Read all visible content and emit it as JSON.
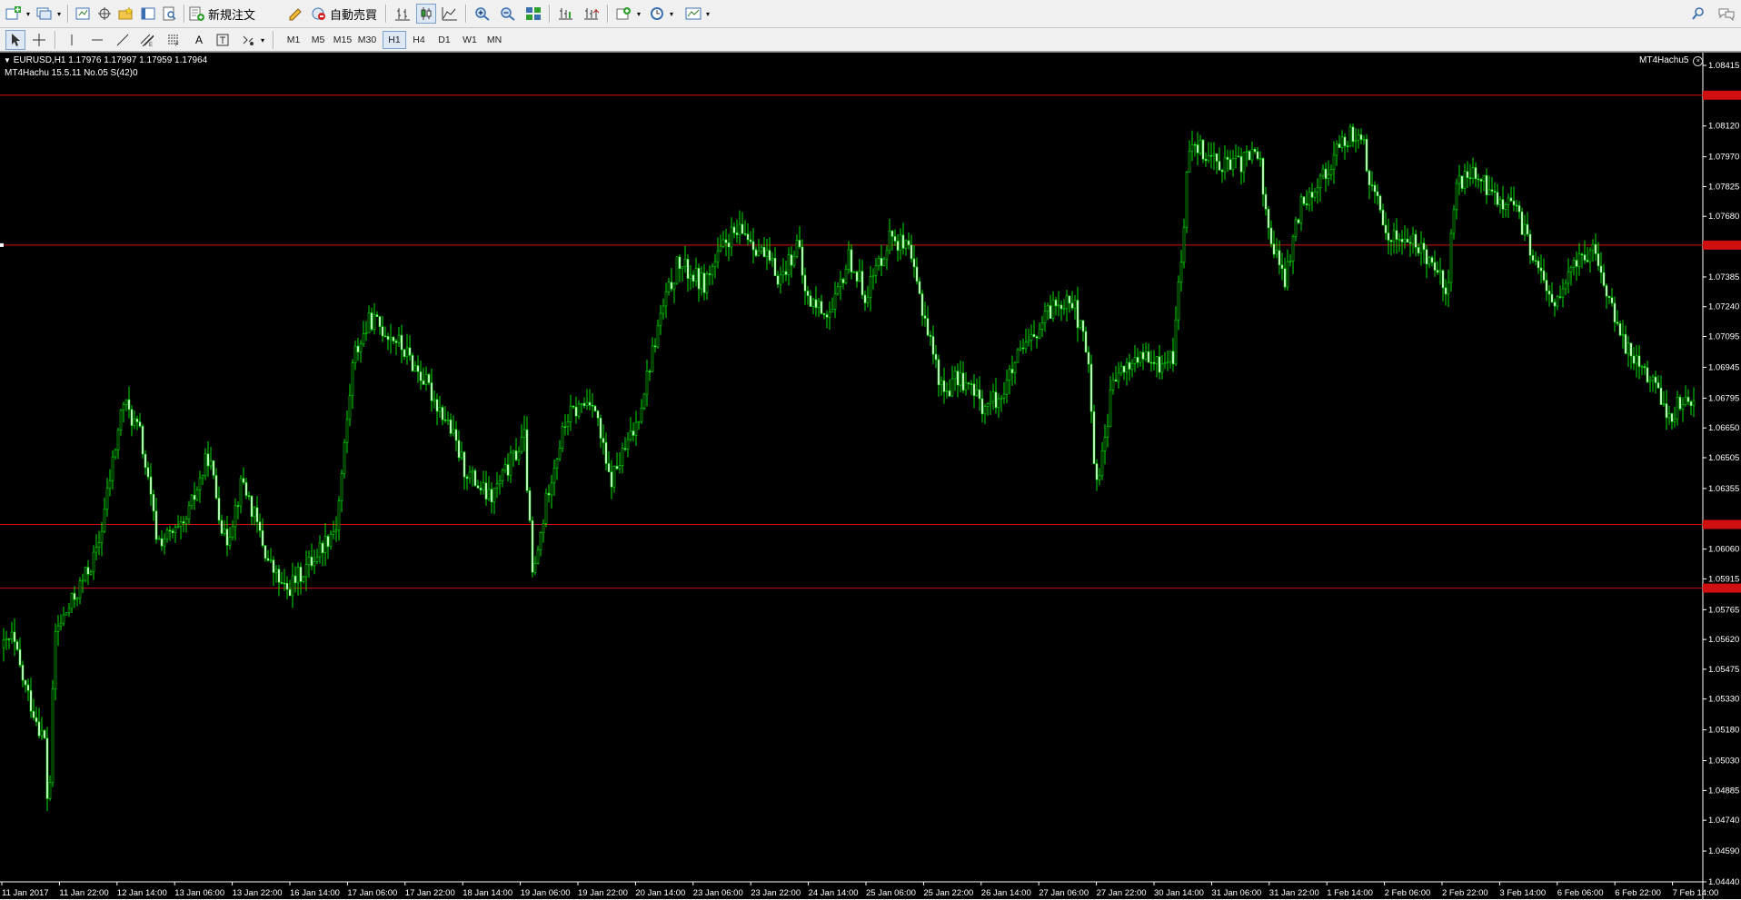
{
  "toolbar": {
    "new_order_label": "新規注文",
    "auto_trading_label": "自動売買",
    "timeframes": [
      "M1",
      "M5",
      "M15",
      "M30",
      "H1",
      "H4",
      "D1",
      "W1",
      "MN"
    ],
    "active_timeframe": "H1"
  },
  "chart_header": {
    "symbol_line": "EURUSD,H1  1.17976 1.17997 1.17959 1.17964",
    "indicator_line": "MT4Hachu 15.5.11   No.05  S(42)0",
    "ea_label": "MT4Hachu5"
  },
  "chart_data": {
    "type": "candlestick",
    "symbol": "EURUSD",
    "timeframe": "H1",
    "ohlc_current": {
      "open": 1.17976,
      "high": 1.17997,
      "low": 1.17959,
      "close": 1.17964
    },
    "y_ticks": [
      "1.08415",
      "1.08120",
      "1.07970",
      "1.07825",
      "1.07680",
      "1.07385",
      "1.07240",
      "1.07095",
      "1.06945",
      "1.06795",
      "1.06650",
      "1.06505",
      "1.06355",
      "1.06060",
      "1.05915",
      "1.05765",
      "1.05620",
      "1.05475",
      "1.05330",
      "1.05180",
      "1.05030",
      "1.04885",
      "1.04740",
      "1.04590",
      "1.04440"
    ],
    "ylim": [
      1.0444,
      1.08415
    ],
    "x_ticks": [
      "11 Jan 2017",
      "11 Jan 22:00",
      "12 Jan 14:00",
      "13 Jan 06:00",
      "13 Jan 22:00",
      "16 Jan 14:00",
      "17 Jan 06:00",
      "17 Jan 22:00",
      "18 Jan 14:00",
      "19 Jan 06:00",
      "19 Jan 22:00",
      "20 Jan 14:00",
      "23 Jan 06:00",
      "23 Jan 22:00",
      "24 Jan 14:00",
      "25 Jan 06:00",
      "25 Jan 22:00",
      "26 Jan 14:00",
      "27 Jan 06:00",
      "27 Jan 22:00",
      "30 Jan 14:00",
      "31 Jan 06:00",
      "31 Jan 22:00",
      "1 Feb 14:00",
      "2 Feb 06:00",
      "2 Feb 22:00",
      "3 Feb 14:00",
      "6 Feb 06:00",
      "6 Feb 22:00",
      "7 Feb 14:00"
    ],
    "horizontal_lines": [
      1.0827,
      1.0754,
      1.0618,
      1.0587
    ],
    "price_path": [
      {
        "t": 0,
        "p": 1.0558
      },
      {
        "t": 0.5,
        "p": 1.0563
      },
      {
        "t": 1.2,
        "p": 1.054
      },
      {
        "t": 2.5,
        "p": 1.051
      },
      {
        "t": 2.6,
        "p": 1.0465
      },
      {
        "t": 3.0,
        "p": 1.0565
      },
      {
        "t": 4.0,
        "p": 1.058
      },
      {
        "t": 5.5,
        "p": 1.0605
      },
      {
        "t": 7.0,
        "p": 1.0678
      },
      {
        "t": 8.0,
        "p": 1.0662
      },
      {
        "t": 9.0,
        "p": 1.061
      },
      {
        "t": 10.5,
        "p": 1.0615
      },
      {
        "t": 12.0,
        "p": 1.0652
      },
      {
        "t": 13.0,
        "p": 1.0608
      },
      {
        "t": 14.0,
        "p": 1.064
      },
      {
        "t": 15.5,
        "p": 1.06
      },
      {
        "t": 16.5,
        "p": 1.0585
      },
      {
        "t": 18.0,
        "p": 1.06
      },
      {
        "t": 19.5,
        "p": 1.0618
      },
      {
        "t": 20.5,
        "p": 1.07
      },
      {
        "t": 21.5,
        "p": 1.0718
      },
      {
        "t": 23.0,
        "p": 1.0708
      },
      {
        "t": 24.5,
        "p": 1.069
      },
      {
        "t": 26.0,
        "p": 1.0668
      },
      {
        "t": 27.0,
        "p": 1.0645
      },
      {
        "t": 28.5,
        "p": 1.063
      },
      {
        "t": 29.5,
        "p": 1.0645
      },
      {
        "t": 30.5,
        "p": 1.066
      },
      {
        "t": 31.0,
        "p": 1.059
      },
      {
        "t": 32.0,
        "p": 1.064
      },
      {
        "t": 33.0,
        "p": 1.067
      },
      {
        "t": 34.5,
        "p": 1.068
      },
      {
        "t": 35.5,
        "p": 1.0638
      },
      {
        "t": 37.0,
        "p": 1.0665
      },
      {
        "t": 38.5,
        "p": 1.072
      },
      {
        "t": 39.5,
        "p": 1.0745
      },
      {
        "t": 41.0,
        "p": 1.0735
      },
      {
        "t": 42.5,
        "p": 1.0758
      },
      {
        "t": 43.5,
        "p": 1.076
      },
      {
        "t": 45.5,
        "p": 1.0738
      },
      {
        "t": 46.5,
        "p": 1.0755
      },
      {
        "t": 47.0,
        "p": 1.0728
      },
      {
        "t": 48.5,
        "p": 1.072
      },
      {
        "t": 49.5,
        "p": 1.0748
      },
      {
        "t": 50.5,
        "p": 1.073
      },
      {
        "t": 52.0,
        "p": 1.076
      },
      {
        "t": 53.0,
        "p": 1.075
      },
      {
        "t": 54.0,
        "p": 1.0718
      },
      {
        "t": 55.0,
        "p": 1.0682
      },
      {
        "t": 56.0,
        "p": 1.069
      },
      {
        "t": 57.5,
        "p": 1.0675
      },
      {
        "t": 58.5,
        "p": 1.0682
      },
      {
        "t": 59.5,
        "p": 1.07
      },
      {
        "t": 60.5,
        "p": 1.071
      },
      {
        "t": 61.5,
        "p": 1.0725
      },
      {
        "t": 62.5,
        "p": 1.073
      },
      {
        "t": 63.5,
        "p": 1.07
      },
      {
        "t": 64.0,
        "p": 1.0635
      },
      {
        "t": 65.0,
        "p": 1.0688
      },
      {
        "t": 66.5,
        "p": 1.07
      },
      {
        "t": 67.5,
        "p": 1.0695
      },
      {
        "t": 68.5,
        "p": 1.07
      },
      {
        "t": 69.0,
        "p": 1.075
      },
      {
        "t": 69.5,
        "p": 1.0808
      },
      {
        "t": 70.5,
        "p": 1.0798
      },
      {
        "t": 72.0,
        "p": 1.0792
      },
      {
        "t": 73.5,
        "p": 1.08
      },
      {
        "t": 74.0,
        "p": 1.0765
      },
      {
        "t": 75.0,
        "p": 1.0735
      },
      {
        "t": 76.0,
        "p": 1.0775
      },
      {
        "t": 77.5,
        "p": 1.079
      },
      {
        "t": 78.5,
        "p": 1.0805
      },
      {
        "t": 79.5,
        "p": 1.081
      },
      {
        "t": 80.0,
        "p": 1.0785
      },
      {
        "t": 81.0,
        "p": 1.076
      },
      {
        "t": 82.5,
        "p": 1.0755
      },
      {
        "t": 84.0,
        "p": 1.0745
      },
      {
        "t": 84.5,
        "p": 1.0725
      },
      {
        "t": 85.0,
        "p": 1.078
      },
      {
        "t": 86.0,
        "p": 1.079
      },
      {
        "t": 87.0,
        "p": 1.078
      },
      {
        "t": 88.5,
        "p": 1.0772
      },
      {
        "t": 89.5,
        "p": 1.0752
      },
      {
        "t": 90.0,
        "p": 1.0738
      },
      {
        "t": 91.0,
        "p": 1.0725
      },
      {
        "t": 92.0,
        "p": 1.0745
      },
      {
        "t": 93.0,
        "p": 1.0752
      },
      {
        "t": 94.0,
        "p": 1.073
      },
      {
        "t": 94.5,
        "p": 1.0712
      },
      {
        "t": 95.5,
        "p": 1.07
      },
      {
        "t": 96.5,
        "p": 1.069
      },
      {
        "t": 97.5,
        "p": 1.067
      },
      {
        "t": 98.5,
        "p": 1.068
      },
      {
        "t": 99.0,
        "p": 1.0678
      }
    ]
  }
}
